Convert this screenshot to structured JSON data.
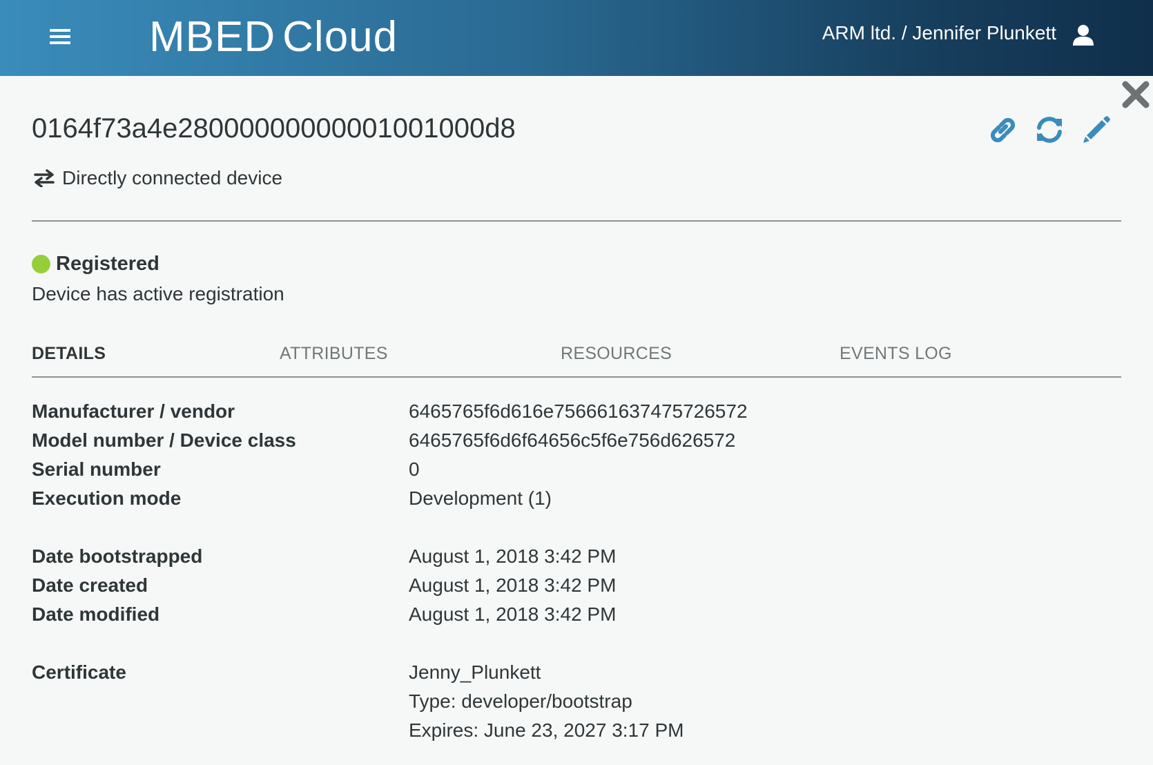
{
  "header": {
    "brand_part1": "MBED",
    "brand_part2": "Cloud",
    "account": "ARM ltd. / Jennifer Plunkett",
    "menu_icon": "hamburger-icon",
    "user_icon": "user-icon"
  },
  "device": {
    "id": "0164f73a4e28000000000001001000d8",
    "connection": "Directly connected device",
    "status_label": "Registered",
    "status_color": "#94cf3a",
    "status_desc": "Device has active registration"
  },
  "actions": [
    {
      "icon": "link-icon"
    },
    {
      "icon": "refresh-icon"
    },
    {
      "icon": "edit-icon"
    }
  ],
  "tabs": [
    {
      "label": "DETAILS",
      "active": true
    },
    {
      "label": "ATTRIBUTES",
      "active": false
    },
    {
      "label": "RESOURCES",
      "active": false
    },
    {
      "label": "EVENTS LOG",
      "active": false
    }
  ],
  "details": {
    "manufacturer": {
      "label": "Manufacturer / vendor",
      "value": "6465765f6d616e756661637475726572"
    },
    "model": {
      "label": "Model number / Device class",
      "value": "6465765f6d6f64656c5f6e756d626572"
    },
    "serial": {
      "label": "Serial number",
      "value": "0"
    },
    "execution": {
      "label": "Execution mode",
      "value": "Development (1)"
    },
    "bootstrapped": {
      "label": "Date bootstrapped",
      "value": "August 1, 2018 3:42 PM"
    },
    "created": {
      "label": "Date created",
      "value": "August 1, 2018 3:42 PM"
    },
    "modified": {
      "label": "Date modified",
      "value": "August 1, 2018 3:42 PM"
    },
    "certificate": {
      "label": "Certificate",
      "name": "Jenny_Plunkett",
      "type": "Type: developer/bootstrap",
      "expires": "Expires: June 23, 2027 3:17 PM"
    }
  },
  "colors": {
    "accent": "#3a8cbb",
    "header_dark": "#0f2f4a"
  }
}
